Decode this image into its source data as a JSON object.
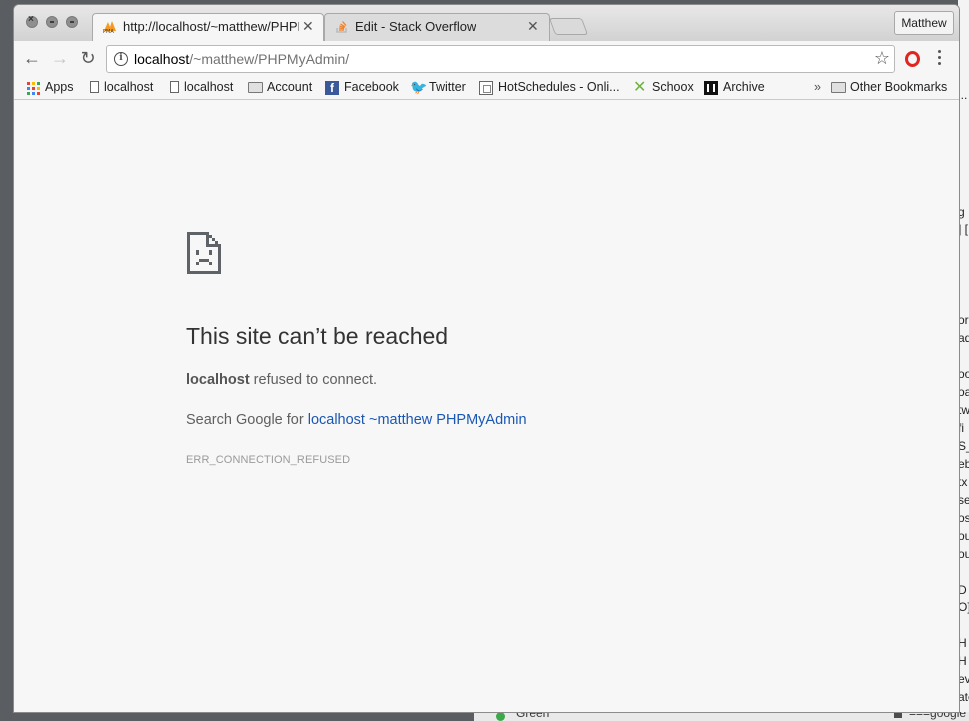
{
  "window": {
    "user_button": "Matthew"
  },
  "tabs": [
    {
      "title": "http://localhost/~matthew/PHPMyAdmin/",
      "favicon": "phpmyadmin-icon",
      "active": true
    },
    {
      "title": "Edit - Stack Overflow",
      "favicon": "stackoverflow-icon",
      "active": false
    }
  ],
  "toolbar": {
    "url_host": "localhost",
    "url_path": "/~matthew/PHPMyAdmin/",
    "back_icon": "←",
    "forward_icon": "→",
    "reload_icon": "↻",
    "star_icon": "☆"
  },
  "bookmarks": {
    "items": [
      {
        "label": "Apps",
        "icon": "apps-grid-icon"
      },
      {
        "label": "localhost",
        "icon": "page-icon"
      },
      {
        "label": "localhost",
        "icon": "page-icon"
      },
      {
        "label": "Account",
        "icon": "folder-icon"
      },
      {
        "label": "Facebook",
        "icon": "facebook-icon"
      },
      {
        "label": "Twitter",
        "icon": "twitter-icon"
      },
      {
        "label": "HotSchedules - Onli...",
        "icon": "hotschedules-icon"
      },
      {
        "label": "Schoox",
        "icon": "schoox-icon"
      },
      {
        "label": "Archive",
        "icon": "archive-icon"
      }
    ],
    "overflow": "»",
    "other": "Other Bookmarks"
  },
  "error_page": {
    "title": "This site can’t be reached",
    "host": "localhost",
    "message": " refused to connect.",
    "search_prefix": "Search Google for ",
    "search_link": "localhost ~matthew PHPMyAdmin",
    "error_code": "ERR_CONNECTION_REFUSED"
  },
  "background": {
    "right_fragments": [
      "i..",
      "g",
      "] [",
      "or",
      "ad",
      "oo",
      "oa",
      "tw",
      "fi",
      "S_",
      "eb",
      "tx",
      "se",
      "os",
      "ou",
      "ou",
      "D",
      "O]",
      "H",
      "H",
      "ev",
      "ate"
    ],
    "bottom_left": "Green",
    "bottom_right": "===google"
  },
  "colors": {
    "link": "#1a57b5",
    "opera_red": "#e0261f",
    "page_bg": "#f7f7f7"
  }
}
